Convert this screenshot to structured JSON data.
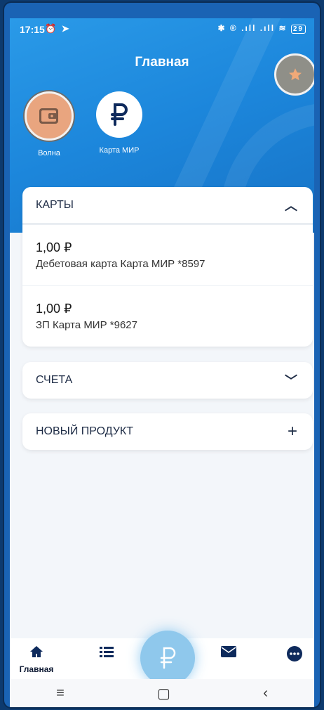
{
  "status_bar": {
    "time": "17:15",
    "left_icons": "⏰ ➤",
    "right_icons": "✱ ® .ıll .ıll",
    "battery": "29"
  },
  "header": {
    "title": "Главная"
  },
  "quick_actions": [
    {
      "label": "Волна",
      "icon": "wallet-icon"
    },
    {
      "label": "Карта МИР",
      "icon": "ruble-icon"
    }
  ],
  "cards_section": {
    "title": "КАРТЫ",
    "expanded": true,
    "items": [
      {
        "amount": "1,00 ₽",
        "name": "Дебетовая карта Карта МИР *8597"
      },
      {
        "amount": "1,00 ₽",
        "name": "ЗП Карта МИР *9627"
      }
    ]
  },
  "accounts_section": {
    "title": "СЧЕТА",
    "expanded": false
  },
  "new_product": {
    "title": "НОВЫЙ ПРОДУКТ"
  },
  "bottom_nav": {
    "home_label": "Главная"
  },
  "colors": {
    "header_blue": "#1c86db",
    "accent_navy": "#0e2a5c",
    "fab_blue": "#8fc8ec",
    "wallet_orange": "#e9a57f"
  }
}
